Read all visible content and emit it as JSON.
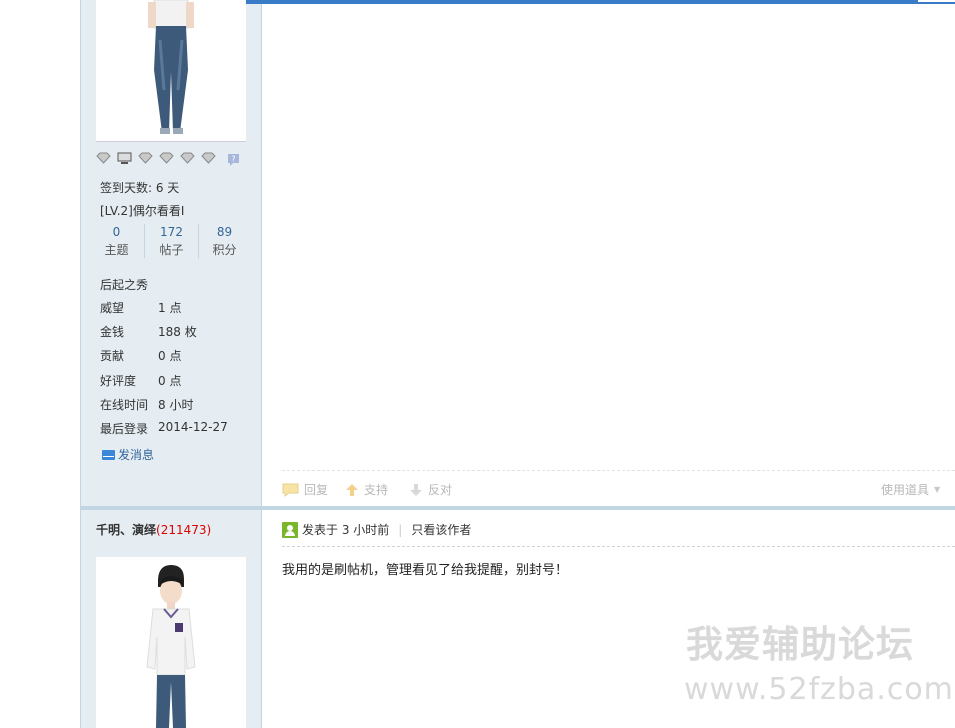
{
  "user1": {
    "sign_days": "签到天数: 6 天",
    "level": "[LV.2]偶尔看看I",
    "counts": [
      {
        "num": "0",
        "label": "主题"
      },
      {
        "num": "172",
        "label": "帖子"
      },
      {
        "num": "89",
        "label": "积分"
      }
    ],
    "group": "后起之秀",
    "info": [
      {
        "k": "威望",
        "v": "1 点"
      },
      {
        "k": "金钱",
        "v": "188 枚"
      },
      {
        "k": "贡献",
        "v": "0 点"
      },
      {
        "k": "好评度",
        "v": "0 点"
      },
      {
        "k": "在线时间",
        "v": "8 小时"
      },
      {
        "k": "最后登录",
        "v": "2014-12-27"
      }
    ],
    "send_message": "发消息"
  },
  "post1_actions": {
    "reply": "回复",
    "support": "支持",
    "oppose": "反对",
    "use_tools": "使用道具"
  },
  "user2": {
    "name": "千明、演绎",
    "uid": "(211473)"
  },
  "post2": {
    "posted": "发表于 3 小时前",
    "only_author": "只看该作者",
    "body": "我用的是刷帖机，管理看见了给我提醒，别封号！"
  },
  "watermark": {
    "cn": "我爱辅助论坛",
    "url": "www.52fzba.com"
  },
  "colors": {
    "sidebar_bg": "#e5edf2",
    "link_blue": "#336699",
    "uid_red": "#dd0000",
    "top_bar": "#3a7bc8"
  }
}
